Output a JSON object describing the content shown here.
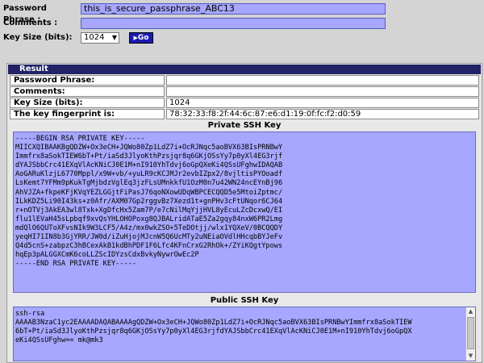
{
  "form": {
    "passphrase_label": "Password Phrase :",
    "passphrase_value": "this_is_secure_passphrase_ABC13",
    "comments_label": "Comments :",
    "comments_value": "",
    "keysize_label": "Key Size (bits):",
    "keysize_selected": "1024",
    "go_label": "Go"
  },
  "result": {
    "title": "Result",
    "rows": [
      {
        "label": "Password Phrase:",
        "value": ""
      },
      {
        "label": "Comments:",
        "value": ""
      },
      {
        "label": "Key Size (bits):",
        "value": "1024"
      },
      {
        "label": "The key fingerprint is:",
        "value": "78:32:33:f8:2f:44:6c:87:e6:d1:19:0f:fc:f2:d0:59"
      }
    ],
    "private_title": "Private SSH Key",
    "private_key": "-----BEGIN RSA PRIVATE KEY-----\nMIICXQIBAAKBgQDZW+Ox3eCH+JQWo80Zp1LdZ7i+OcRJNqc5aoBVX63BIsPRNBwY\nImmfrx8aSokTIEW6bT+Pt/iaSd3JlyoKthPzsjqr8q6GKjOSsYy7p0yXl4EG3rjf\ndYAJSbbCrc41EXqVlAcKNiCJ0E1M+nI910YhTdvj6oGpQXeKi4QSsUFghwIDAQAB\nAoGARuKlzjL6770Mppl/x9W+vb/+yuLR9cKCJMJr2evbIZpx2/8vjltisPYOoadf\nLsKemt7YFMm9pKukTgMjbdzVglEq3jzFLsUMnkkfU1OzM0n7u42WN24ncEYnBj96\nAhVJZA+fkpeKFjKVqYEZLGGjtFiPasJ76qoNXowUDqWBPCECQQD5e5MtoiZptmc/\nILkKDZ5Li90I43ks+z0Afr/AXM07Gp2rggvBz7Xezd1t+gnPHv3cFtUNqor6CJ64\nr+nOTVj3AkEA3wl8Txk+XgDfcHx5Zam7P/e7cNilMqYjjHVL8yEcuLZcDcxwQ/EI\nflu1lEVaH45sLpbqf9xvQsYHLOHOPoxg8QJBALridATaE5Za2gqy84nxW6PR2Lmg\nmdQlO6QUToXFvsNIk9W3LCF5/A4z/mx0wkZSO+5TeDOtjj/wlx1YQXeV/0BCQQDY\nyeqHI71IN8b3GjYRR/JW0d/iZuHjojMJcnW5Q6UcMTy2uNEiaOVdlHHcqbBYJeFv\nQ4d5cnS+zabpzC3hBCexAkB1kdBhPDF1F6Lfc4KFnCrxG2RhOk+/ZYiKQgtYpows\nhqEp3pALGGXCmK6coLLZScIDYzsCdxBvkyNywrOwEc2P\n-----END RSA PRIVATE KEY-----",
    "public_title": "Public SSH Key",
    "public_key": "ssh-rsa\nAAAAB3NzaC1yc2EAAAADAQABAAAAgQDZW+Ox3eCH+JQWo80Zp1LdZ7i+OcRJNqc5aoBVX63BIsPRNBwYImmfrx8aSokTIEW\n6bT+Pt/iaSd3JlyoKthPzsjqr8q6GKjOSsYy7p0yXl4EG3rjfdYAJSbbCrc41EXqVlAcKNiCJ0E1M+nI910YhTdvj6oGpQX\neKi4QSsUFghw== mk@mk3"
  }
}
